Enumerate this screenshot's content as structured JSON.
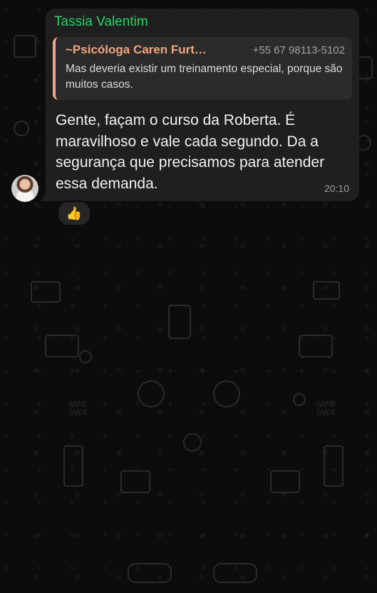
{
  "message": {
    "sender": "Tassia Valentim",
    "sender_color": "#25d366",
    "quoted": {
      "name": "~Psicóloga Caren Furt…",
      "phone": "+55 67 98113-5102",
      "text": "Mas deveria existir um treinamento especial, porque são muitos casos.",
      "accent_color": "#f2a57e"
    },
    "body": "Gente, façam o curso da Roberta. É maravilhoso e vale cada segundo. Da a segurança que precisamos para atender essa demanda.",
    "time": "20:10",
    "reaction": "👍"
  },
  "icons": {
    "avatar": "user-avatar",
    "reaction": "thumbs-up-icon"
  }
}
